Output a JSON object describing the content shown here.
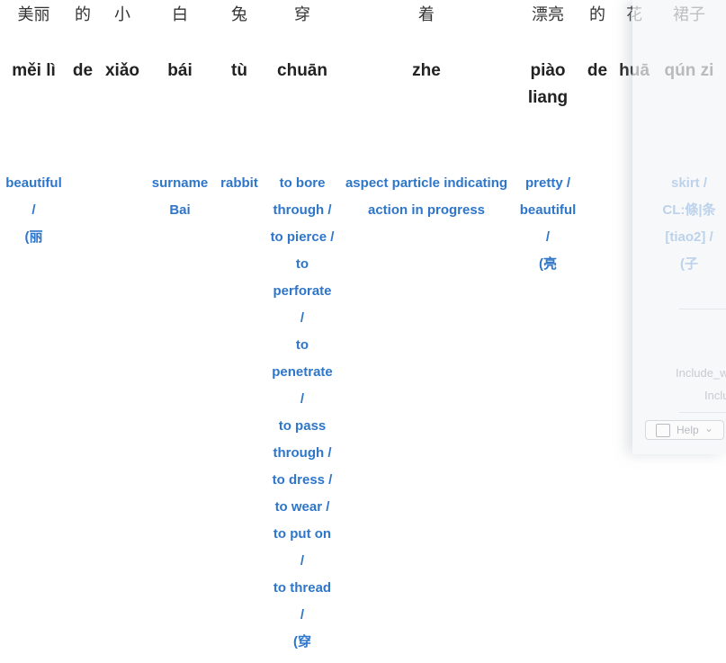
{
  "words": [
    {
      "hanzi": "美丽",
      "pinyin": [
        "měi lì"
      ],
      "definition": [
        "beautiful",
        "/",
        "(丽"
      ]
    },
    {
      "hanzi": "的",
      "pinyin": [
        "de"
      ],
      "definition": []
    },
    {
      "hanzi": "小",
      "pinyin": [
        "xiǎo"
      ],
      "definition": []
    },
    {
      "hanzi": "白",
      "pinyin": [
        "bái"
      ],
      "definition": [
        "surname",
        "Bai"
      ]
    },
    {
      "hanzi": "兔",
      "pinyin": [
        "tù"
      ],
      "definition": [
        "rabbit"
      ]
    },
    {
      "hanzi": "穿",
      "pinyin": [
        "chuān"
      ],
      "definition": [
        "to bore",
        "through /",
        "to pierce /",
        "to",
        "perforate",
        "/",
        "to",
        "penetrate",
        "/",
        "to pass",
        "through /",
        "to dress /",
        "to wear /",
        "to put on",
        "/",
        "to thread",
        "/",
        "(穿"
      ]
    },
    {
      "hanzi": "着",
      "pinyin": [
        "zhe"
      ],
      "definition": [
        "aspect particle indicating",
        "action in progress"
      ]
    },
    {
      "hanzi": "漂亮",
      "pinyin": [
        "piào",
        "liang"
      ],
      "definition": [
        "pretty /",
        "beautiful",
        "/",
        "(亮"
      ]
    },
    {
      "hanzi": "的",
      "pinyin": [
        "de"
      ],
      "definition": []
    },
    {
      "hanzi": "花",
      "pinyin": [
        "huā"
      ],
      "definition": []
    },
    {
      "hanzi": "裙子",
      "pinyin": [
        "qún zi"
      ],
      "definition": [
        "skirt /",
        "CL:條|条",
        "[tiao2] /",
        "(子"
      ]
    }
  ],
  "panel": {
    "text1": "Include_w",
    "text2": "Inclu",
    "help_label": "Help",
    "help_icon": "help-book-icon",
    "chevron_icon": "chevron-down-icon"
  },
  "colors": {
    "definition": "#2e76c9",
    "pinyin": "#222222",
    "hanzi": "#333333"
  }
}
